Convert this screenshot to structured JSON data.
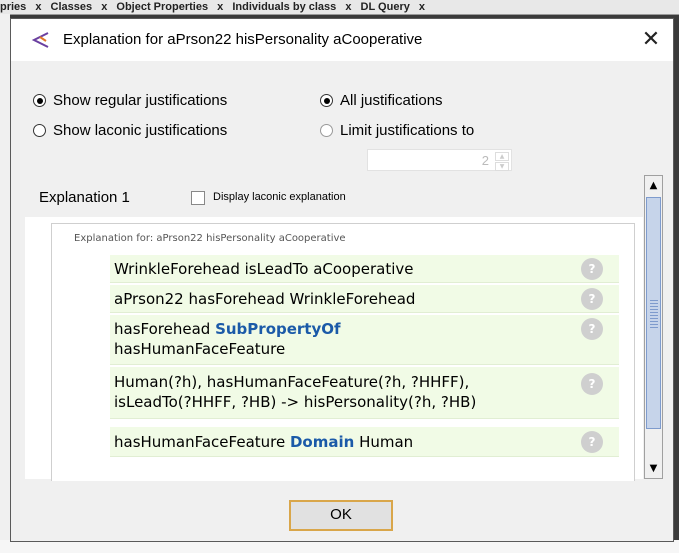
{
  "background": {
    "tabs": [
      "pries",
      "x",
      "Classes",
      "x",
      "Object Properties",
      "x",
      "Individuals by class",
      "x",
      "DL Query",
      "x"
    ]
  },
  "dialog": {
    "title": "Explanation for aPrson22 hisPersonality aCooperative",
    "close_label": "✕",
    "options": {
      "show_regular": "Show regular justifications",
      "show_laconic": "Show laconic justifications",
      "all_justifications": "All justifications",
      "limit_justifications": "Limit justifications to",
      "limit_value": "2"
    },
    "explanation_title": "Explanation 1",
    "display_laconic_label": "Display laconic explanation",
    "explanation_for": "Explanation for: aPrson22 hisPersonality aCooperative",
    "help_glyph": "?",
    "axioms": [
      {
        "pre": "WrinkleForehead isLeadTo aCooperative",
        "kw": "",
        "post": "",
        "line2": ""
      },
      {
        "pre": "aPrson22 hasForehead WrinkleForehead",
        "kw": "",
        "post": "",
        "line2": ""
      },
      {
        "pre": "hasForehead ",
        "kw": "SubPropertyOf",
        "post": "",
        "line2": "hasHumanFaceFeature"
      },
      {
        "pre": "Human(?h), hasHumanFaceFeature(?h, ?HHFF),",
        "kw": "",
        "post": "",
        "line2": "isLeadTo(?HHFF, ?HB) -> hisPersonality(?h, ?HB)"
      },
      {
        "pre": "hasHumanFaceFeature ",
        "kw": "Domain",
        "post": " Human",
        "line2": ""
      }
    ],
    "ok_label": "OK"
  },
  "colors": {
    "accent": "#1b5aa8",
    "axiom_bg": "#f1fbe6",
    "ok_border": "#d9a64a"
  },
  "icons": {
    "title": "protege-icon",
    "help": "help-icon"
  }
}
